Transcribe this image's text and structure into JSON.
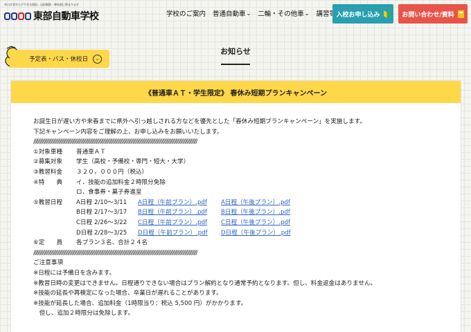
{
  "header": {
    "tagline": "市川大学からアクセス良好。山形駅前・神社前に停まります",
    "logo_text": "東部自動車学校",
    "nav": [
      {
        "label": "学校のご案内"
      },
      {
        "label": "普通自動車"
      },
      {
        "label": "二輪・その他車"
      },
      {
        "label": "講習等"
      }
    ],
    "apply_button": "入校お申し込み",
    "contact_button": "お問い合わせ/資料",
    "colors": {
      "apply": "#2a9fb0",
      "contact": "#e8544a",
      "accent": "#ffd84a"
    }
  },
  "schedule_tab": {
    "label": "予定表・バス・休校日"
  },
  "page_title": "お知らせ",
  "card": {
    "title": "《普通車ＡＴ・学生限定》 春休み短期プランキャンペーン",
    "intro": [
      "お誕生日が遅い方や来春までに県外へ引っ越しされる方などを優先とした「春休み短期プランキャンペーン」を実施します。",
      "下記キャンペーン内容をご理解の上、お申し込みをお願いいたします。"
    ],
    "separator": "////////////////////////////////////////////////////////////////////////////////////////////////////////////////////////////////////////////////////",
    "items": [
      {
        "label": "①対象車種",
        "value": "普通車ＡＴ"
      },
      {
        "label": "②募集対象",
        "value": "学生（高校・予備校・専門・短大・大学）"
      },
      {
        "label": "③教習料金",
        "value": "３２０，０００円（税込）"
      },
      {
        "label": "④特　　典",
        "value": "イ．技能の追加料金２時限分免除"
      },
      {
        "label": "",
        "value": "ロ．食事券・菓子券進呈"
      }
    ],
    "schedule_label": "⑤教習日程",
    "schedules": [
      {
        "name": "A日程",
        "dates": "2/10〜3/11",
        "am": "A日程（午前プラン）.pdf",
        "pm": "A日程（午後プラン）.pdf"
      },
      {
        "name": "B日程",
        "dates": "2/17〜3/17",
        "am": "B日程（午前プラン）.pdf",
        "pm": "B日程（午後プラン）.pdf"
      },
      {
        "name": "C日程",
        "dates": "2/26〜3/22",
        "am": "C日程（午前プラン）.pdf",
        "pm": "C日程（午後プラン）.pdf"
      },
      {
        "name": "D日程",
        "dates": "2/28〜3/25",
        "am": "D日程（午前プラン）.pdf",
        "pm": "D日程（午後プラン）.pdf"
      }
    ],
    "capacity_label": "⑥定　　員",
    "capacity_value": "各プラン３名、合計２４名",
    "notes_title": "ご注意事項",
    "notes": [
      "※日程には予備日を含みます。",
      "※教習日時の変更はできません。日程通りできない場合はプラン解約となり通常予約となります。但し、料金返金はありません。",
      "※技能の延長や再検定になった場合、卒業日が遅れることがあります。",
      "※技能が延長した場合、追加料金（1時限当り：税込 5,500 円）がかかります。",
      "　但し、追加２時限分は免除します。"
    ]
  }
}
